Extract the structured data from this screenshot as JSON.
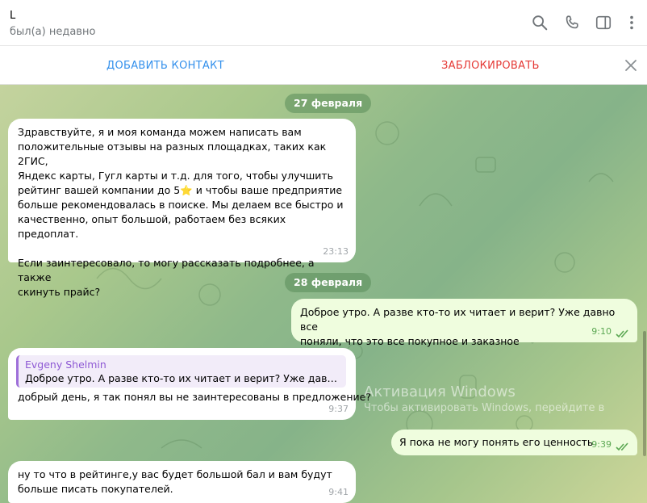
{
  "header": {
    "name": "L",
    "status": "был(а) недавно",
    "icons": [
      "search-icon",
      "phone-icon",
      "sidebar-icon",
      "more-vertical-icon"
    ]
  },
  "actions": {
    "add_contact": "ДОБАВИТЬ КОНТАКТ",
    "block": "ЗАБЛОКИРОВАТЬ"
  },
  "colors": {
    "accent": "#3390ec",
    "danger": "#e53935",
    "outgoing_bubble": "#effdde",
    "read_check": "#5ca853"
  },
  "messages": {
    "date1": "27 февраля",
    "date2": "28 февраля",
    "m1": {
      "text": "Здравствуйте, я и моя команда можем написать вам\nположительные отзывы на разных площадках, таких как 2ГИС,\nЯндекс карты, Гугл карты и т.д. для того, чтобы улучшить\nрейтинг вашей компании до 5⭐ и чтобы ваше предприятие\nбольше рекомендовалась в поиске. Мы делаем все быстро и\nкачественно, опыт большой, работаем без всяких предоплат.\n\nЕсли заинтересовало, то могу рассказать подробнее, а также\nскинуть прайс?",
      "time": "23:13"
    },
    "m2": {
      "text": "Доброе утро. А разве кто-то их читает и верит? Уже давно все\nпоняли, что это все покупное и заказное",
      "time": "9:10"
    },
    "m3": {
      "reply_name": "Evgeny Shelmin",
      "reply_text": "Доброе утро. А разве кто-то их читает и верит? Уже давно все поняли, что это все покупное и заказное",
      "text": "добрый день, я так понял вы не заинтересованы в предложение?",
      "time": "9:37"
    },
    "m4": {
      "text": "Я пока не могу понять его ценность",
      "time": "9:39"
    },
    "m5": {
      "text": "ну то что в рейтинге,у вас будет большой бал и вам будут\nбольше писать покупателей.",
      "time": "9:41"
    }
  },
  "watermark": {
    "title": "Активация Windows",
    "subtitle": "Чтобы активировать Windows, перейдите в"
  }
}
